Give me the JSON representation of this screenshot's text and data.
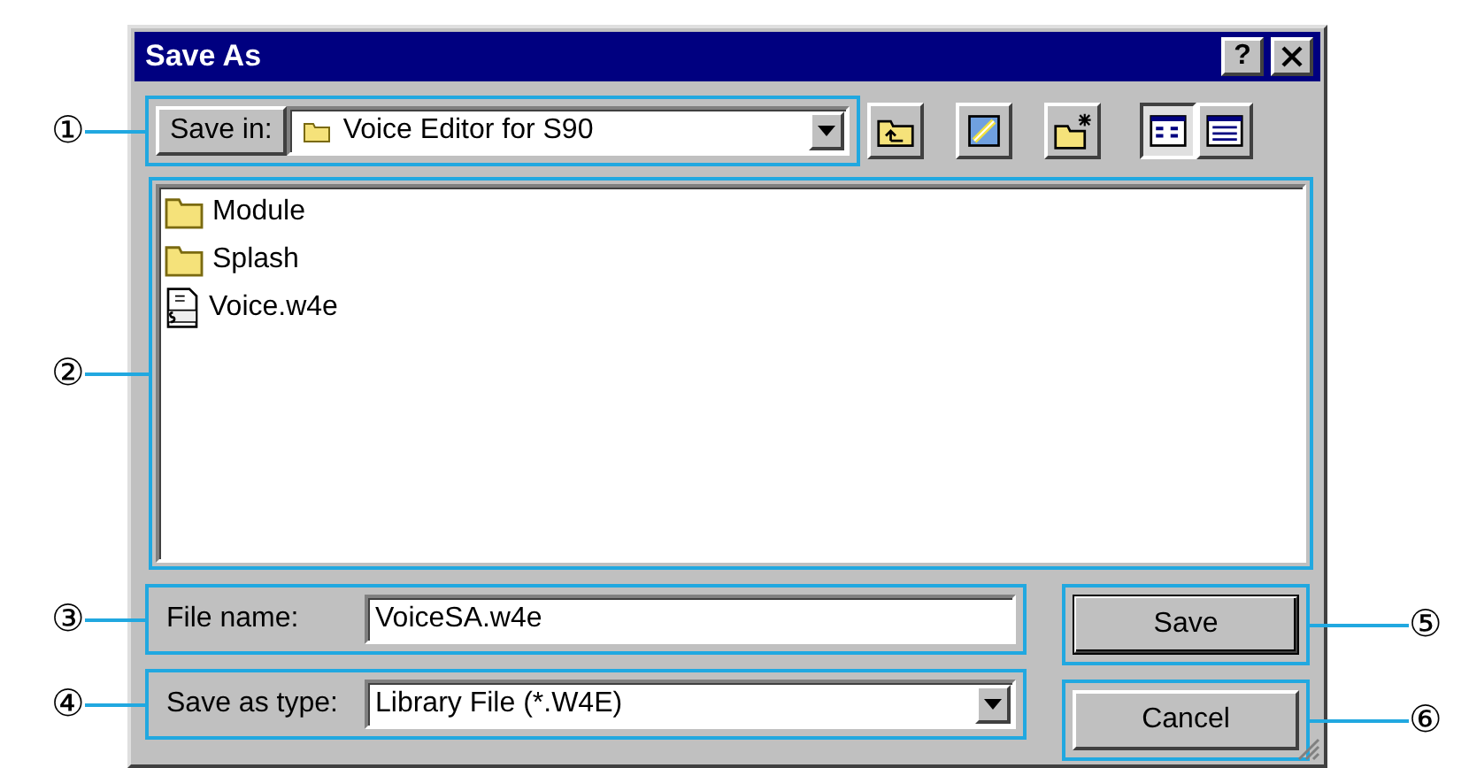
{
  "window": {
    "title": "Save As",
    "title_buttons": [
      {
        "kind": "help",
        "label": "?"
      },
      {
        "kind": "close"
      }
    ]
  },
  "save_in": {
    "label": "Save in:",
    "value": "Voice Editor for S90",
    "callout": "①"
  },
  "toolbar": [
    {
      "kind": "up"
    },
    {
      "kind": "desktop"
    },
    {
      "kind": "new_folder"
    },
    {
      "kind": "list",
      "selected": true
    },
    {
      "kind": "details",
      "selected": false
    }
  ],
  "file_list": {
    "callout": "②",
    "items": [
      {
        "name": "Module",
        "kind": "folder"
      },
      {
        "name": "Splash",
        "kind": "folder"
      },
      {
        "name": "Voice.w4e",
        "kind": "voice_file"
      }
    ]
  },
  "file_name": {
    "label": "File name:",
    "value": "VoiceSA.w4e",
    "callout": "③"
  },
  "save_as_type": {
    "label": "Save as type:",
    "value": "Library File (*.W4E)",
    "callout": "④"
  },
  "buttons": [
    {
      "label": "Save",
      "default": true,
      "callout": "⑤"
    },
    {
      "label": "Cancel",
      "default": false,
      "callout": "⑥"
    }
  ]
}
